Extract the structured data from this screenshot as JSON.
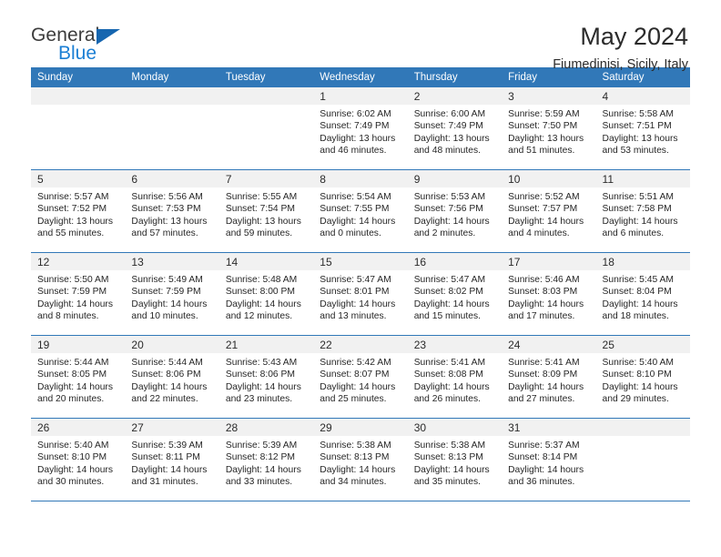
{
  "brand": {
    "name_top": "General",
    "name_bottom": "Blue",
    "triangle_color": "#1666b0",
    "blue_text_color": "#1b7fd4"
  },
  "header": {
    "title": "May 2024",
    "subtitle": "Fiumedinisi, Sicily, Italy"
  },
  "theme": {
    "header_blue": "#3178b8",
    "daynum_gray": "#f1f1f1",
    "text": "#262626"
  },
  "weekdays": [
    "Sunday",
    "Monday",
    "Tuesday",
    "Wednesday",
    "Thursday",
    "Friday",
    "Saturday"
  ],
  "labels": {
    "sunrise_prefix": "Sunrise:",
    "sunset_prefix": "Sunset:",
    "daylight_prefix": "Daylight:"
  },
  "weeks": [
    [
      {
        "day": "",
        "empty": true
      },
      {
        "day": "",
        "empty": true
      },
      {
        "day": "",
        "empty": true
      },
      {
        "day": "1",
        "sunrise": "Sunrise: 6:02 AM",
        "sunset": "Sunset: 7:49 PM",
        "daylight1": "Daylight: 13 hours",
        "daylight2": "and 46 minutes."
      },
      {
        "day": "2",
        "sunrise": "Sunrise: 6:00 AM",
        "sunset": "Sunset: 7:49 PM",
        "daylight1": "Daylight: 13 hours",
        "daylight2": "and 48 minutes."
      },
      {
        "day": "3",
        "sunrise": "Sunrise: 5:59 AM",
        "sunset": "Sunset: 7:50 PM",
        "daylight1": "Daylight: 13 hours",
        "daylight2": "and 51 minutes."
      },
      {
        "day": "4",
        "sunrise": "Sunrise: 5:58 AM",
        "sunset": "Sunset: 7:51 PM",
        "daylight1": "Daylight: 13 hours",
        "daylight2": "and 53 minutes."
      }
    ],
    [
      {
        "day": "5",
        "sunrise": "Sunrise: 5:57 AM",
        "sunset": "Sunset: 7:52 PM",
        "daylight1": "Daylight: 13 hours",
        "daylight2": "and 55 minutes."
      },
      {
        "day": "6",
        "sunrise": "Sunrise: 5:56 AM",
        "sunset": "Sunset: 7:53 PM",
        "daylight1": "Daylight: 13 hours",
        "daylight2": "and 57 minutes."
      },
      {
        "day": "7",
        "sunrise": "Sunrise: 5:55 AM",
        "sunset": "Sunset: 7:54 PM",
        "daylight1": "Daylight: 13 hours",
        "daylight2": "and 59 minutes."
      },
      {
        "day": "8",
        "sunrise": "Sunrise: 5:54 AM",
        "sunset": "Sunset: 7:55 PM",
        "daylight1": "Daylight: 14 hours",
        "daylight2": "and 0 minutes."
      },
      {
        "day": "9",
        "sunrise": "Sunrise: 5:53 AM",
        "sunset": "Sunset: 7:56 PM",
        "daylight1": "Daylight: 14 hours",
        "daylight2": "and 2 minutes."
      },
      {
        "day": "10",
        "sunrise": "Sunrise: 5:52 AM",
        "sunset": "Sunset: 7:57 PM",
        "daylight1": "Daylight: 14 hours",
        "daylight2": "and 4 minutes."
      },
      {
        "day": "11",
        "sunrise": "Sunrise: 5:51 AM",
        "sunset": "Sunset: 7:58 PM",
        "daylight1": "Daylight: 14 hours",
        "daylight2": "and 6 minutes."
      }
    ],
    [
      {
        "day": "12",
        "sunrise": "Sunrise: 5:50 AM",
        "sunset": "Sunset: 7:59 PM",
        "daylight1": "Daylight: 14 hours",
        "daylight2": "and 8 minutes."
      },
      {
        "day": "13",
        "sunrise": "Sunrise: 5:49 AM",
        "sunset": "Sunset: 7:59 PM",
        "daylight1": "Daylight: 14 hours",
        "daylight2": "and 10 minutes."
      },
      {
        "day": "14",
        "sunrise": "Sunrise: 5:48 AM",
        "sunset": "Sunset: 8:00 PM",
        "daylight1": "Daylight: 14 hours",
        "daylight2": "and 12 minutes."
      },
      {
        "day": "15",
        "sunrise": "Sunrise: 5:47 AM",
        "sunset": "Sunset: 8:01 PM",
        "daylight1": "Daylight: 14 hours",
        "daylight2": "and 13 minutes."
      },
      {
        "day": "16",
        "sunrise": "Sunrise: 5:47 AM",
        "sunset": "Sunset: 8:02 PM",
        "daylight1": "Daylight: 14 hours",
        "daylight2": "and 15 minutes."
      },
      {
        "day": "17",
        "sunrise": "Sunrise: 5:46 AM",
        "sunset": "Sunset: 8:03 PM",
        "daylight1": "Daylight: 14 hours",
        "daylight2": "and 17 minutes."
      },
      {
        "day": "18",
        "sunrise": "Sunrise: 5:45 AM",
        "sunset": "Sunset: 8:04 PM",
        "daylight1": "Daylight: 14 hours",
        "daylight2": "and 18 minutes."
      }
    ],
    [
      {
        "day": "19",
        "sunrise": "Sunrise: 5:44 AM",
        "sunset": "Sunset: 8:05 PM",
        "daylight1": "Daylight: 14 hours",
        "daylight2": "and 20 minutes."
      },
      {
        "day": "20",
        "sunrise": "Sunrise: 5:44 AM",
        "sunset": "Sunset: 8:06 PM",
        "daylight1": "Daylight: 14 hours",
        "daylight2": "and 22 minutes."
      },
      {
        "day": "21",
        "sunrise": "Sunrise: 5:43 AM",
        "sunset": "Sunset: 8:06 PM",
        "daylight1": "Daylight: 14 hours",
        "daylight2": "and 23 minutes."
      },
      {
        "day": "22",
        "sunrise": "Sunrise: 5:42 AM",
        "sunset": "Sunset: 8:07 PM",
        "daylight1": "Daylight: 14 hours",
        "daylight2": "and 25 minutes."
      },
      {
        "day": "23",
        "sunrise": "Sunrise: 5:41 AM",
        "sunset": "Sunset: 8:08 PM",
        "daylight1": "Daylight: 14 hours",
        "daylight2": "and 26 minutes."
      },
      {
        "day": "24",
        "sunrise": "Sunrise: 5:41 AM",
        "sunset": "Sunset: 8:09 PM",
        "daylight1": "Daylight: 14 hours",
        "daylight2": "and 27 minutes."
      },
      {
        "day": "25",
        "sunrise": "Sunrise: 5:40 AM",
        "sunset": "Sunset: 8:10 PM",
        "daylight1": "Daylight: 14 hours",
        "daylight2": "and 29 minutes."
      }
    ],
    [
      {
        "day": "26",
        "sunrise": "Sunrise: 5:40 AM",
        "sunset": "Sunset: 8:10 PM",
        "daylight1": "Daylight: 14 hours",
        "daylight2": "and 30 minutes."
      },
      {
        "day": "27",
        "sunrise": "Sunrise: 5:39 AM",
        "sunset": "Sunset: 8:11 PM",
        "daylight1": "Daylight: 14 hours",
        "daylight2": "and 31 minutes."
      },
      {
        "day": "28",
        "sunrise": "Sunrise: 5:39 AM",
        "sunset": "Sunset: 8:12 PM",
        "daylight1": "Daylight: 14 hours",
        "daylight2": "and 33 minutes."
      },
      {
        "day": "29",
        "sunrise": "Sunrise: 5:38 AM",
        "sunset": "Sunset: 8:13 PM",
        "daylight1": "Daylight: 14 hours",
        "daylight2": "and 34 minutes."
      },
      {
        "day": "30",
        "sunrise": "Sunrise: 5:38 AM",
        "sunset": "Sunset: 8:13 PM",
        "daylight1": "Daylight: 14 hours",
        "daylight2": "and 35 minutes."
      },
      {
        "day": "31",
        "sunrise": "Sunrise: 5:37 AM",
        "sunset": "Sunset: 8:14 PM",
        "daylight1": "Daylight: 14 hours",
        "daylight2": "and 36 minutes."
      },
      {
        "day": "",
        "empty": true
      }
    ]
  ]
}
